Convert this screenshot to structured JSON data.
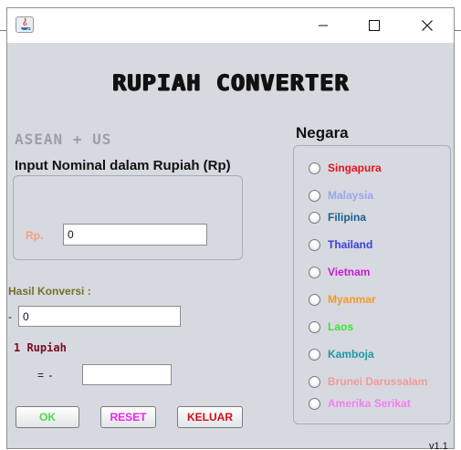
{
  "window": {
    "title": "",
    "controls": [
      "minimize-icon",
      "maximize-icon",
      "close-icon"
    ]
  },
  "app": {
    "title": "RUPIAH CONVERTER",
    "subtitle": "ASEAN + US",
    "version": "v1.1"
  },
  "input_section": {
    "label": "Input Nominal dalam Rupiah (Rp)",
    "rp_label": "Rp.",
    "value": "0"
  },
  "result_section": {
    "label": "Hasil Konversi :",
    "prefix": "-",
    "value": "0",
    "rate_label": "1 Rupiah",
    "equals_text": "=   -",
    "rate_value": ""
  },
  "buttons": {
    "ok": "OK",
    "reset": "RESET",
    "keluar": "KELUAR"
  },
  "negara": {
    "label": "Negara",
    "options": [
      {
        "label": "Singapura",
        "color": "#e8121e"
      },
      {
        "label": "Malaysia",
        "color": "#9aa6ee"
      },
      {
        "label": "Filipina",
        "color": "#1d5e8c"
      },
      {
        "label": "Thailand",
        "color": "#3b3fdb"
      },
      {
        "label": "Vietnam",
        "color": "#cc18d6"
      },
      {
        "label": "Myanmar",
        "color": "#f6972c"
      },
      {
        "label": "Laos",
        "color": "#3ae63a"
      },
      {
        "label": "Kamboja",
        "color": "#1c9aa2"
      },
      {
        "label": "Brunei Darussalam",
        "color": "#f29a9a"
      },
      {
        "label": "Amerika Serikat",
        "color": "#f77ef0"
      }
    ]
  },
  "colors": {
    "window_bg": "#d6d9df",
    "rp_label": "#f4a07c",
    "hasil_label": "#77702a",
    "satu_rupiah": "#7a0b22"
  }
}
